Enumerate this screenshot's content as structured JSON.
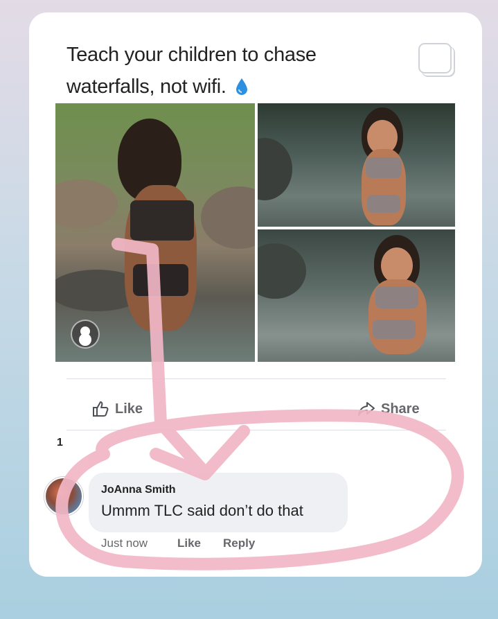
{
  "post": {
    "text_line1": "Teach your children to chase",
    "text_line2": "waterfalls, not wifi.",
    "emoji_icon": "droplet-icon"
  },
  "actions": {
    "like_label": "Like",
    "share_label": "Share"
  },
  "comments": {
    "count": "1",
    "items": [
      {
        "author": "JoAnna Smith",
        "text": "Ummm TLC said don’t do that",
        "time": "Just now",
        "like_label": "Like",
        "reply_label": "Reply"
      }
    ]
  },
  "colors": {
    "annotation": "#f1b6c6",
    "card_bg": "#ffffff",
    "bubble_bg": "#eef0f3",
    "meta_text": "#65676b"
  }
}
